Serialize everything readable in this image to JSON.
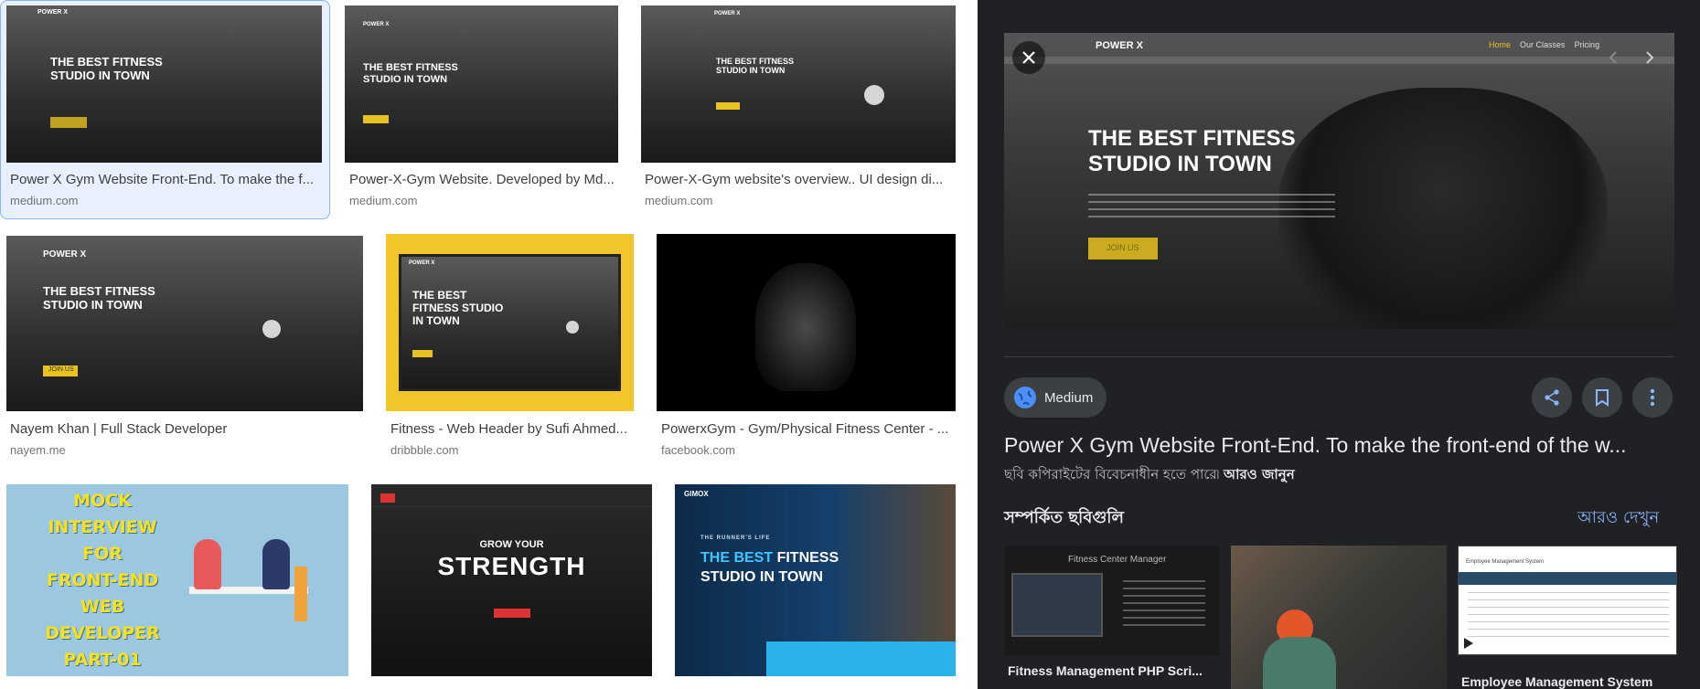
{
  "results": [
    {
      "title": "Power X Gym Website Front-End. To make the f...",
      "source": "medium.com",
      "img_title": "THE BEST FITNESS STUDIO IN TOWN",
      "brand": "POWER X"
    },
    {
      "title": "Power-X-Gym Website. Developed by Md...",
      "source": "medium.com",
      "img_title": "THE BEST FITNESS STUDIO IN TOWN",
      "brand": "POWER X"
    },
    {
      "title": "Power-X-Gym website's overview.. UI design di...",
      "source": "medium.com",
      "img_title": "THE BEST FITNESS STUDIO IN TOWN",
      "brand": "POWER X"
    },
    {
      "title": "Nayem Khan | Full Stack Developer",
      "source": "nayem.me",
      "img_title": "THE BEST FITNESS STUDIO IN TOWN",
      "brand": "POWER X",
      "button": "JOIN US"
    },
    {
      "title": "Fitness - Web Header by Sufi Ahmed...",
      "source": "dribbble.com",
      "img_title": "THE BEST FITNESS STUDIO IN TOWN",
      "brand": "POWER X"
    },
    {
      "title": "PowerxGym - Gym/Physical Fitness Center - ...",
      "source": "facebook.com"
    },
    {
      "img_lines": [
        "MOCK",
        "INTERVIEW",
        "FOR",
        "FRONT-END",
        "WEB",
        "DEVELOPER",
        "PART-01"
      ]
    },
    {
      "img_title_top": "GROW YOUR",
      "img_title": "STRENGTH"
    },
    {
      "brand": "GIMOX",
      "img_subtitle": "THE RUNNER'S LIFE",
      "img_title_a": "THE BEST",
      "img_title_b": "FITNESS",
      "img_title_c": "STUDIO IN TOWN"
    }
  ],
  "panel": {
    "preview": {
      "brand": "POWER X",
      "title": "THE BEST FITNESS STUDIO IN TOWN",
      "button": "JOIN US",
      "nav": [
        "Home",
        "Our Classes",
        "Pricing"
      ]
    },
    "source_name": "Medium",
    "title": "Power X Gym Website Front-End. To make the front-end of the w...",
    "copyright_text": "ছবি কপিরাইটের বিবেচনাধীন হতে পারে৷",
    "learn_more": "আরও জানুন",
    "related_heading": "সম্পর্কিত ছবিগুলি",
    "see_more": "আরও দেখুন",
    "related": [
      {
        "label": "Fitness Management PHP Scri...",
        "img_text": "Fitness Center Manager"
      },
      {
        "label": ""
      },
      {
        "label": "Employee Management System",
        "img_text": "Employee Management System"
      }
    ]
  },
  "colors": {
    "panel_bg": "#202124",
    "accent_link": "#8ab4f8",
    "yellow": "#e8c21f"
  }
}
